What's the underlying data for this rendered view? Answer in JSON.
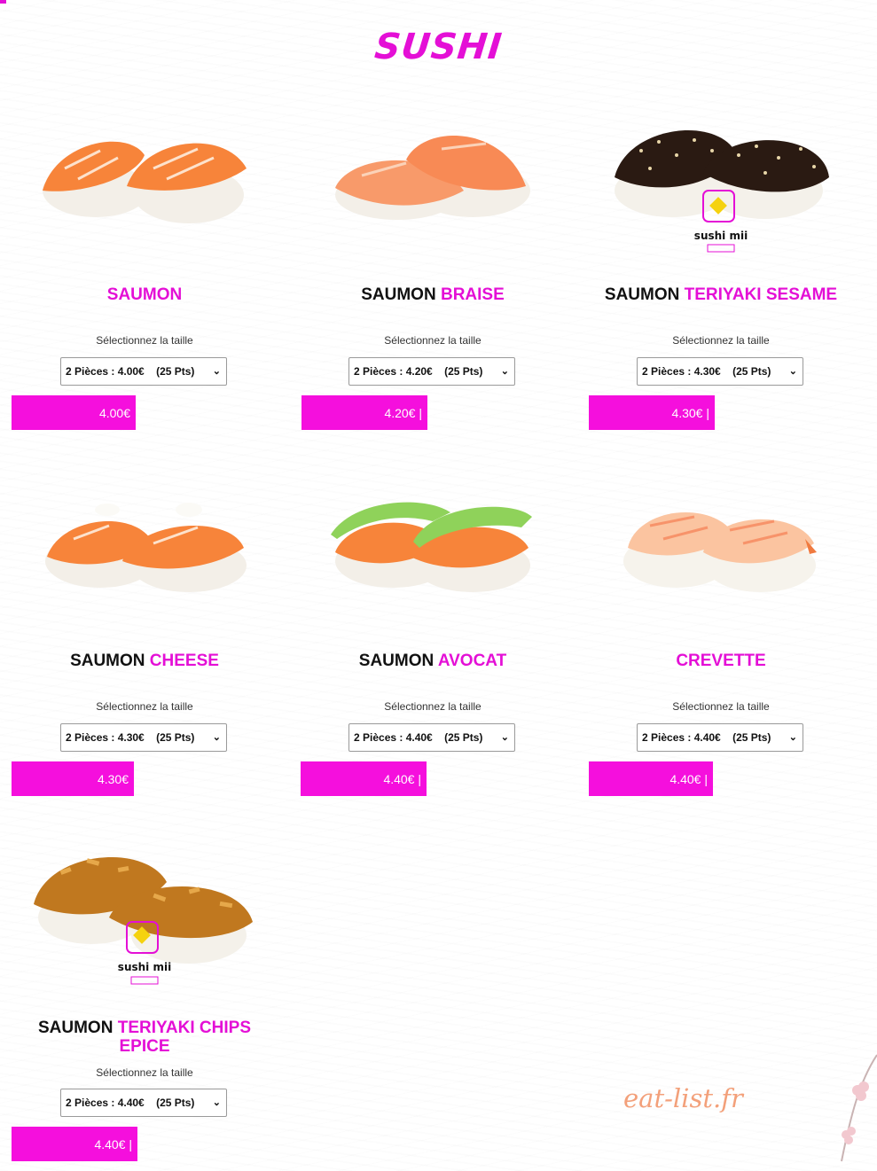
{
  "page": {
    "title": "SUSHI",
    "watermark": "eat-list.fr",
    "accent_color": "#e40fd6"
  },
  "products": [
    {
      "name_dark": "",
      "name_pink": "SAUMON",
      "size_label": "Sélectionnez la taille",
      "selected_option": "2 Pièces : 4.00€    (25 Pts)",
      "price": "4.00€",
      "image": "salmon-nigiri"
    },
    {
      "name_dark": "SAUMON",
      "name_pink": "BRAISE",
      "size_label": "Sélectionnez la taille",
      "selected_option": "2 Pièces : 4.20€    (25 Pts)",
      "price": "4.20€ |",
      "image": "seared-salmon-nigiri"
    },
    {
      "name_dark": "SAUMON",
      "name_pink": "TERIYAKI SESAME",
      "size_label": "Sélectionnez la taille",
      "selected_option": "2 Pièces : 4.30€    (25 Pts)",
      "price": "4.30€ |",
      "image": "sesame-nigiri",
      "logo_text": "sushi mii"
    },
    {
      "name_dark": "SAUMON",
      "name_pink": "CHEESE",
      "size_label": "Sélectionnez la taille",
      "selected_option": "2 Pièces : 4.30€    (25 Pts)",
      "price": "4.30€",
      "image": "salmon-cheese-nigiri"
    },
    {
      "name_dark": "SAUMON",
      "name_pink": "AVOCAT",
      "size_label": "Sélectionnez la taille",
      "selected_option": "2 Pièces : 4.40€    (25 Pts)",
      "price": "4.40€ |",
      "image": "salmon-avocado-nigiri"
    },
    {
      "name_dark": "",
      "name_pink": "CREVETTE",
      "size_label": "Sélectionnez la taille",
      "selected_option": "2 Pièces : 4.40€    (25 Pts)",
      "price": "4.40€ |",
      "image": "shrimp-nigiri"
    },
    {
      "name_dark": "SAUMON",
      "name_pink": "TERIYAKI CHIPS EPICE",
      "size_label": "Sélectionnez la taille",
      "selected_option": "2 Pièces : 4.40€    (25 Pts)",
      "price": "4.40€ |",
      "image": "chips-nigiri",
      "logo_text": "sushi mii"
    }
  ]
}
